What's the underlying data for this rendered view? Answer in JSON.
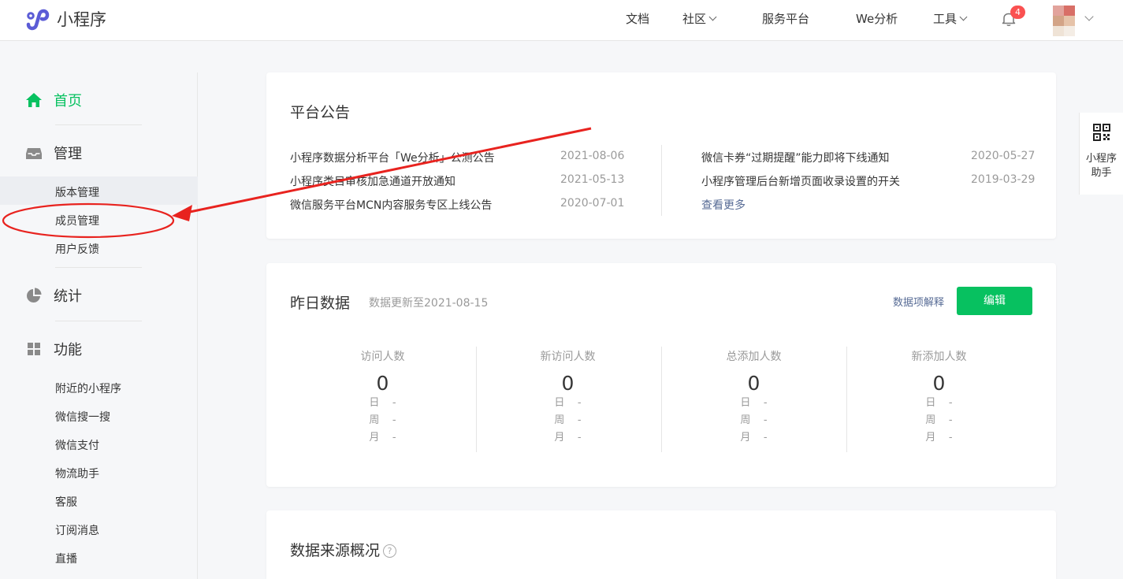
{
  "header": {
    "logo_text": "小程序",
    "nav": [
      {
        "label": "文档",
        "has_dropdown": false
      },
      {
        "label": "社区",
        "has_dropdown": true
      },
      {
        "label": "服务平台",
        "has_dropdown": false
      },
      {
        "label": "We分析",
        "has_dropdown": false
      },
      {
        "label": "工具",
        "has_dropdown": true
      }
    ],
    "notification_count": "4"
  },
  "sidebar": {
    "home": "首页",
    "manage": "管理",
    "manage_items": [
      "版本管理",
      "成员管理",
      "用户反馈"
    ],
    "stats": "统计",
    "features": "功能",
    "feature_items": [
      "附近的小程序",
      "微信搜一搜",
      "微信支付",
      "物流助手",
      "客服",
      "订阅消息",
      "直播"
    ],
    "icons": {
      "home": "home-icon",
      "manage": "inbox-icon",
      "stats": "pie-chart-icon",
      "features": "grid-icon"
    },
    "accent_color": "#07c160"
  },
  "announcements": {
    "title": "平台公告",
    "left": [
      {
        "text": "小程序数据分析平台「We分析」公测公告",
        "date": "2021-08-06"
      },
      {
        "text": "小程序类目审核加急通道开放通知",
        "date": "2021-05-13"
      },
      {
        "text": "微信服务平台MCN内容服务专区上线公告",
        "date": "2020-07-01"
      }
    ],
    "right": [
      {
        "text": "微信卡券“过期提醒”能力即将下线通知",
        "date": "2020-05-27"
      },
      {
        "text": "小程序管理后台新增页面收录设置的开关",
        "date": "2019-03-29"
      }
    ],
    "more": "查看更多"
  },
  "yesterday": {
    "title": "昨日数据",
    "updated": "数据更新至2021-08-15",
    "explain_link": "数据项解释",
    "edit_button": "编辑",
    "stats": [
      {
        "label": "访问人数",
        "value": "0",
        "day": "日",
        "week": "周",
        "month": "月",
        "day_val": "-",
        "week_val": "-",
        "month_val": "-"
      },
      {
        "label": "新访问人数",
        "value": "0",
        "day": "日",
        "week": "周",
        "month": "月",
        "day_val": "-",
        "week_val": "-",
        "month_val": "-"
      },
      {
        "label": "总添加人数",
        "value": "0",
        "day": "日",
        "week": "周",
        "month": "月",
        "day_val": "-",
        "week_val": "-",
        "month_val": "-"
      },
      {
        "label": "新添加人数",
        "value": "0",
        "day": "日",
        "week": "周",
        "month": "月",
        "day_val": "-",
        "week_val": "-",
        "month_val": "-"
      }
    ]
  },
  "source": {
    "title": "数据来源概况",
    "help": "?"
  },
  "assistant": {
    "line1": "小程序",
    "line2": "助手",
    "icon": "qr-code-icon"
  },
  "annotation": {
    "color": "#e8231f"
  }
}
